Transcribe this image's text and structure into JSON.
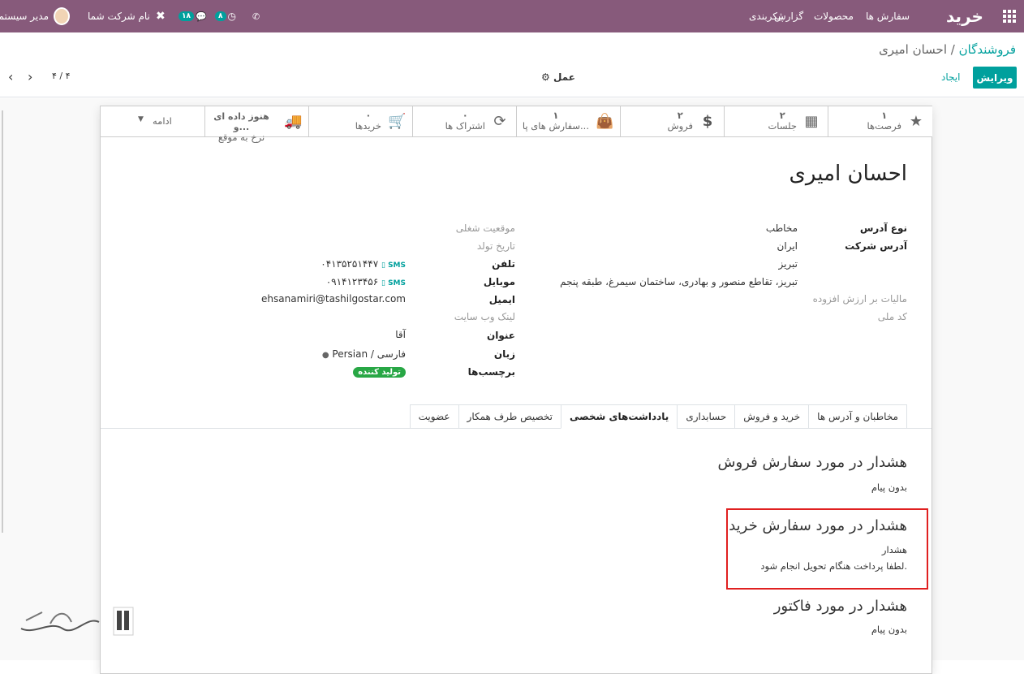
{
  "navbar": {
    "app_name": "خرید",
    "menu": [
      "سفارش ها",
      "محصولات",
      "گزارش",
      "پیکربندی"
    ],
    "user_name": "مدیر سیستم",
    "company": "نام شرکت شما",
    "messages_count": "۱۸",
    "activities_count": "۸",
    "bg_color": "#875a7b"
  },
  "breadcrumb": {
    "parent": "فروشندگان",
    "separator": "/",
    "current": "احسان امیری"
  },
  "controls": {
    "edit": "ویرایش",
    "create": "ایجاد",
    "action": "عمل",
    "pager": "۴ / ۴"
  },
  "smart_buttons": [
    {
      "count": "۱",
      "label": "فرصت‌ها",
      "icon": "star-icon"
    },
    {
      "count": "۲",
      "label": "جلسات",
      "icon": "calendar-icon"
    },
    {
      "count": "۲",
      "label": "فروش",
      "icon": "dollar-icon"
    },
    {
      "count": "۱",
      "label": "سفارش های پا...",
      "icon": "shopping-bag-icon"
    },
    {
      "count": "۰",
      "label": "اشتراک ها",
      "icon": "refresh-icon"
    },
    {
      "count": "۰",
      "label": "خریدها",
      "icon": "cart-icon"
    },
    {
      "count": "هنوز داده ای و...",
      "label": "نرخ به موقع",
      "icon": "truck-icon"
    },
    {
      "count": "",
      "label": "ادامه",
      "icon": "caret-down-icon"
    }
  ],
  "partner": {
    "name": "احسان امیری",
    "address_type_label": "نوع آدرس",
    "address_type": "مخاطب",
    "company_address_label": "آدرس شرکت",
    "country": "ایران",
    "city": "تبریز",
    "street": "تبریز، تقاطع منصور و بهادری، ساختمان سیمرغ، طبقه پنجم",
    "vat_label": "مالیات بر ارزش افزوده",
    "national_id_label": "کد ملی",
    "job_position_label": "موقعیت شغلی",
    "birthdate_label": "تاریخ تولد",
    "phone_label": "تلفن",
    "phone": "۰۴۱۳۵۲۵۱۴۴۷",
    "mobile_label": "موبایل",
    "mobile": "۰۹۱۴۱۲۳۴۵۶",
    "sms": "SMS",
    "email_label": "ایمیل",
    "email": "ehsanamiri@tashilgostar.com",
    "website_label": "لینک وب سایت",
    "title_label": "عنوان",
    "title": "آقا",
    "lang_label": "زبان",
    "lang": "Persian / فارسی",
    "tags_label": "برچسب‌ها",
    "tag": "تولید کننده"
  },
  "tabs": [
    "مخاطبان و آدرس ها",
    "خرید و فروش",
    "حسابداری",
    "یادداشت‌های شخصی",
    "تخصیص طرف همکار",
    "عضویت"
  ],
  "active_tab": 3,
  "notes": {
    "sale_title": "هشدار در مورد سفارش فروش",
    "sale_value": "بدون پیام",
    "purchase_title": "هشدار در مورد سفارش خرید",
    "purchase_level": "هشدار",
    "purchase_message": "لطفا پرداخت هنگام تحویل انجام شود.",
    "invoice_title": "هشدار در مورد فاکتور",
    "invoice_value": "بدون پیام"
  }
}
